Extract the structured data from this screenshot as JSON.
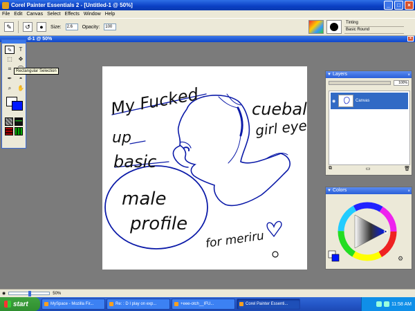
{
  "window": {
    "title": "Corel Painter Essentials 2 - [Untitled-1 @ 50%]",
    "doc_title": "d-1 @ 50%"
  },
  "menu": [
    "File",
    "Edit",
    "Canvas",
    "Select",
    "Effects",
    "Window",
    "Help"
  ],
  "toolbar": {
    "size_label": "Size:",
    "size_value": "2.6",
    "opacity_label": "Opacity:",
    "opacity_value": "100"
  },
  "brush": {
    "category": "Tinting",
    "variant": "Basic Round"
  },
  "toolbox": {
    "tooltip": "Rectangular Selection",
    "main_color": "#ffffff",
    "secondary_color": "#0018ff"
  },
  "canvas_text": {
    "line1": "My Fucked",
    "line2": "up",
    "line3": "basic",
    "bubble": [
      "male",
      "profile"
    ],
    "right1": "cueball",
    "right2": "girl eye",
    "sig": "for meriru"
  },
  "layers_panel": {
    "title": "Layers",
    "opacity": "100%",
    "layer_name": "Canvas"
  },
  "colors_panel": {
    "title": "Colors"
  },
  "status": {
    "zoom": "50%"
  },
  "taskbar": {
    "start": "start",
    "tasks": [
      "MySpace - Mozilla Fir...",
      "Re: : D I play on exp...",
      "+eee-otch__IFU...",
      "Corel Painter Essenti..."
    ],
    "clock": "11:58 AM"
  },
  "accent": "#0018ff"
}
